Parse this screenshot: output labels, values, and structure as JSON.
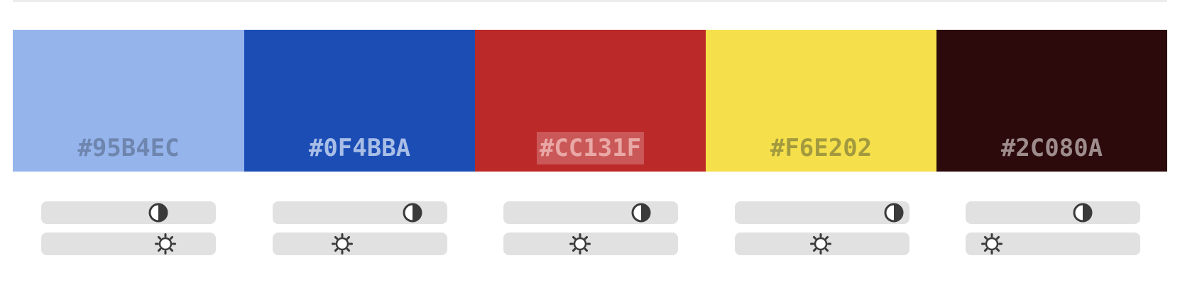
{
  "swatches": [
    {
      "hex": "#95B4EC",
      "color": "#95B4EC",
      "text_color": "#6E85AE",
      "contrast": 0.67,
      "brightness": 0.71,
      "contrast_icon": "contrast-icon",
      "brightness_icon": "sun-icon"
    },
    {
      "hex": "#0F4BBA",
      "color": "#1B4DB5",
      "text_color": "#A9BEE6",
      "contrast": 0.8,
      "brightness": 0.4,
      "contrast_icon": "contrast-icon",
      "brightness_icon": "sun-icon"
    },
    {
      "hex": "#CC131F",
      "color": "#BB2A29",
      "text_color": "#E9A8A6",
      "contrast": 0.79,
      "brightness": 0.44,
      "contrast_icon": "contrast-icon",
      "brightness_icon": "sun-icon",
      "selected": true
    },
    {
      "hex": "#F6E202",
      "color": "#F5E04B",
      "text_color": "#A39A3F",
      "contrast": 0.91,
      "brightness": 0.49,
      "contrast_icon": "contrast-icon",
      "brightness_icon": "sun-icon"
    },
    {
      "hex": "#2C080A",
      "color": "#2C0A0B",
      "text_color": "#9E8C8C",
      "contrast": 0.67,
      "brightness": 0.15,
      "contrast_icon": "contrast-icon",
      "brightness_icon": "sun-icon"
    }
  ]
}
